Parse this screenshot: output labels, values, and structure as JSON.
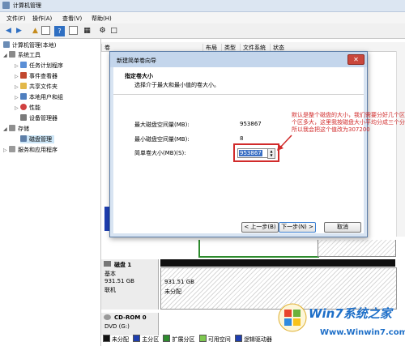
{
  "window": {
    "title": "计算机管理"
  },
  "menu": [
    "文件(F)",
    "操作(A)",
    "查看(V)",
    "帮助(H)"
  ],
  "tree": {
    "root": "计算机管理(本地)",
    "system_tools": "系统工具",
    "task_scheduler": "任务计划程序",
    "event_viewer": "事件查看器",
    "shared_folders": "共享文件夹",
    "local_users": "本地用户和组",
    "performance": "性能",
    "device_manager": "设备管理器",
    "storage": "存储",
    "disk_management": "磁盘管理",
    "services_apps": "服务和应用程序"
  },
  "columns": [
    "卷",
    "布局",
    "类型",
    "文件系统",
    "状态"
  ],
  "dialog": {
    "title": "新建简单卷向导",
    "heading": "指定卷大小",
    "subheading": "选择介于最大和最小值的卷大小。",
    "max_label": "最大磁盘空间量(MB):",
    "max_value": "953867",
    "min_label": "最小磁盘空间量(MB):",
    "min_value": "8",
    "size_label": "简单卷大小(MB)(S):",
    "size_value": "953867",
    "back_button": "< 上一步(B)",
    "next_button": "下一步(N) >",
    "cancel_button": "取消"
  },
  "annotation": "默认是整个磁盘的大小，我们需要分好几个区，每个区多大，这里我按磁盘大小平均分成三个分区，所以我会把这个值改为307200",
  "disks": [
    {
      "name": "磁盘 1",
      "type": "基本",
      "size": "931.51 GB",
      "status": "联机",
      "part_size": "931.51 GB",
      "part_status": "未分配"
    },
    {
      "name": "CD-ROM 0",
      "type": "DVD (G:)"
    }
  ],
  "legend": [
    {
      "label": "未分配",
      "color": "#111111"
    },
    {
      "label": "主分区",
      "color": "#1f3fb0"
    },
    {
      "label": "扩展分区",
      "color": "#2e8b2e"
    },
    {
      "label": "可用空间",
      "color": "#7ec850"
    },
    {
      "label": "逻辑驱动器",
      "color": "#1f3fb0"
    }
  ],
  "watermark": {
    "logo": "Win7系统之家",
    "url": "Www.Winwin7.com"
  }
}
